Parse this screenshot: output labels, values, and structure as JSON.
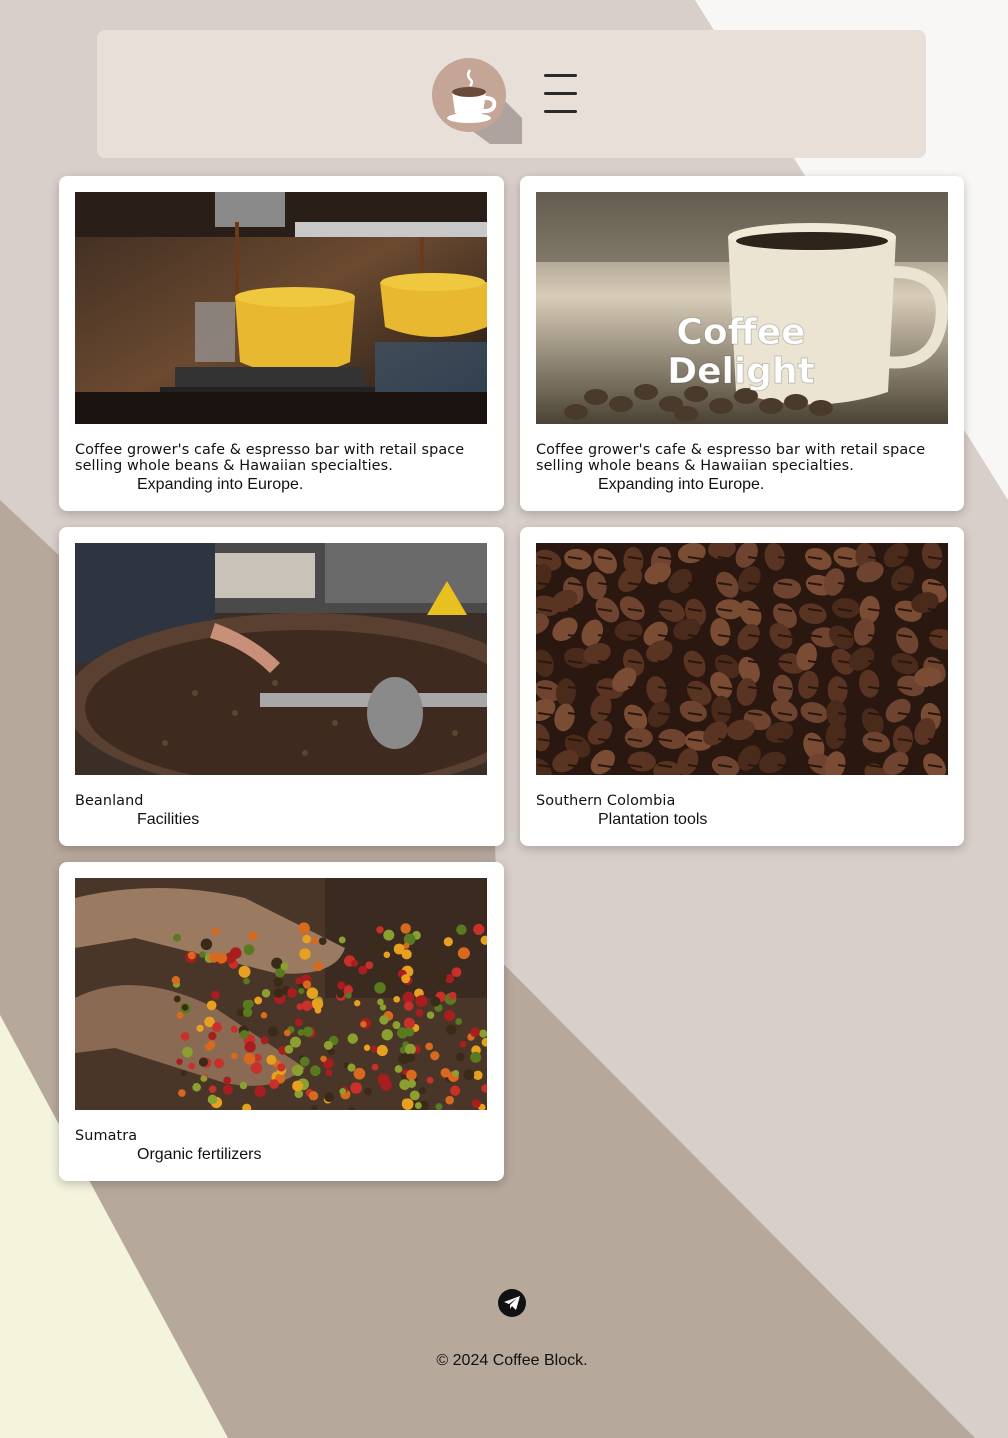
{
  "header": {
    "logo_icon": "coffee-cup-logo-icon",
    "menu_icon": "hamburger-menu-icon"
  },
  "cards": [
    {
      "title": "Coffee grower's cafe & espresso bar with retail space selling whole beans & Hawaiian specialties.",
      "subtitle": "Expanding into Europe.",
      "image": "espresso-pour-photo"
    },
    {
      "title": "Coffee grower's cafe & espresso bar with retail space selling whole beans & Hawaiian specialties.",
      "subtitle": "Expanding into Europe.",
      "image": "coffee-cup-beans-photo",
      "overlay_line1": "Coffee",
      "overlay_line2": "Delight"
    },
    {
      "title": "Beanland",
      "subtitle": "Facilities",
      "image": "coffee-roaster-photo"
    },
    {
      "title": "Southern Colombia",
      "subtitle": "Plantation tools",
      "image": "roasted-beans-photo"
    },
    {
      "title": "Sumatra",
      "subtitle": "Organic fertilizers",
      "image": "coffee-cherries-hands-photo"
    }
  ],
  "footer": {
    "social_icon": "telegram-icon",
    "copyright": "© 2024 Coffee Block."
  },
  "colors": {
    "background_light": "#d9cfca",
    "background_dark": "#b7a89c",
    "background_cream": "#f4f3dc",
    "header_bg": "#e9dfd9",
    "card_bg": "#ffffff"
  }
}
